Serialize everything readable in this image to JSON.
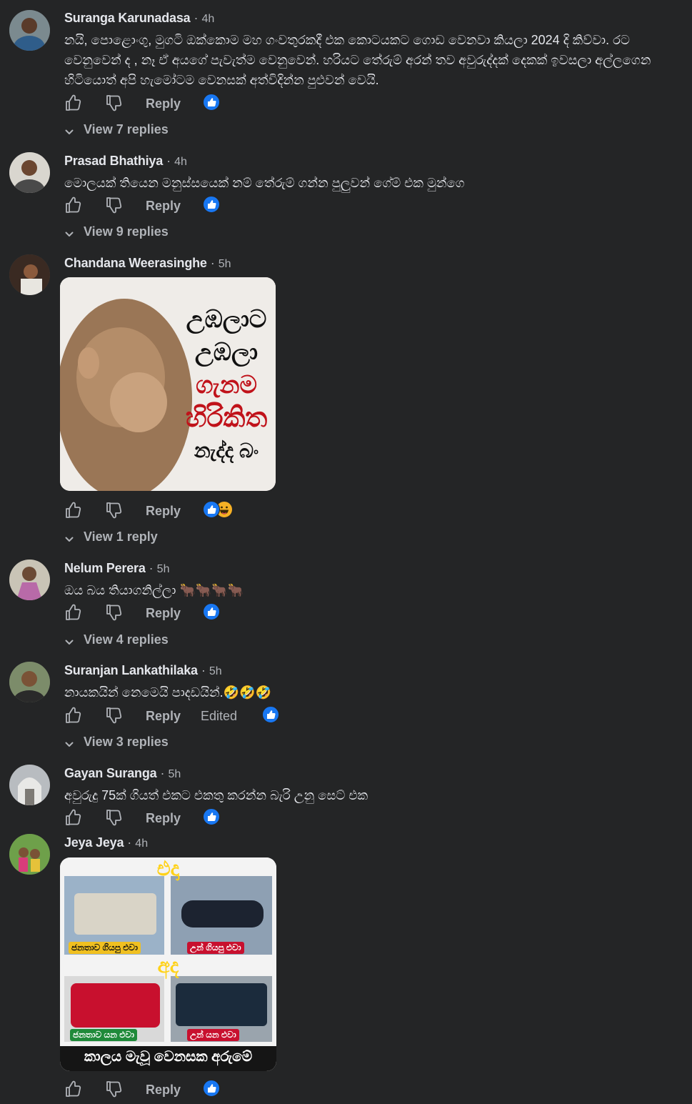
{
  "actions": {
    "reply_label": "Reply",
    "edited_label": "Edited"
  },
  "comments": [
    {
      "author": "Suranga Karunadasa",
      "time": "4h",
      "text": "නයි, පොළොංගු, මුගටි ඔක්කොම මහ ගංවතුරකදී එක කොටයකට ගොඩ වෙනවා කියලා 2024 දි කිව්වා. රට වෙනුවෙන් ද , නෑ ඒ අයගේ පැවැත්ම වෙනුවෙන්. හරියට තේරුම් අරන් තව අවුරුද්දක් දෙකක් ඉවසලා අල්ලගෙන හිටියොත් අපි හැමෝටම වෙනසක් අත්විදින්න පුළුවන් වෙයි.",
      "reactions": [
        "like"
      ],
      "view_replies": "View 7 replies"
    },
    {
      "author": "Prasad Bhathiya",
      "time": "4h",
      "text": "මොලයක් තියෙන මනුස්සයෙක් නම් තේරුම් ගන්න පුලුවන් ගේම් එක මුන්ගෙ",
      "reactions": [
        "like"
      ],
      "view_replies": "View 9 replies"
    },
    {
      "author": "Chandana Weerasinghe",
      "time": "5h",
      "image_text": [
        "උඹලාට",
        "උඹලා",
        "ගැනම",
        "හිරිකිත",
        "නැද්ද බං"
      ],
      "reactions": [
        "like",
        "haha"
      ],
      "view_replies": "View 1 reply"
    },
    {
      "author": "Nelum Perera",
      "time": "5h",
      "text": "ඔය බය තියාගනිල්ලා 🐂🐂🐂🐂",
      "reactions": [
        "like"
      ],
      "view_replies": "View 4 replies"
    },
    {
      "author": "Suranjan Lankathilaka",
      "time": "5h",
      "text": "නායකයින් නෙමෙයි පාදඩයින්.🤣🤣🤣",
      "edited": true,
      "reactions": [
        "like"
      ],
      "view_replies": "View 3 replies"
    },
    {
      "author": "Gayan Suranga",
      "time": "5h",
      "text": "අවුරුදු 75ක් ගියත් එකට එකතු කරන්න බැරි උනු සෙට් එක",
      "reactions": [
        "like"
      ]
    },
    {
      "author": "Jeya Jeya",
      "time": "4h",
      "image_text": {
        "then": "එදා",
        "people_then": "ජනතාව ගියපු එවා",
        "they_then": "උන් ගියපු එවා",
        "now": "අද",
        "people_now": "ජනතාව යන එවා",
        "they_now": "උන් යන එවා",
        "footer": "කාලය මැවූ වෙනසක අරුමේ"
      },
      "reactions": [
        "like"
      ]
    }
  ],
  "colors": {
    "background": "#242526",
    "text": "#e4e6eb",
    "muted": "#b0b3b8",
    "like_blue": "#1877f2"
  }
}
